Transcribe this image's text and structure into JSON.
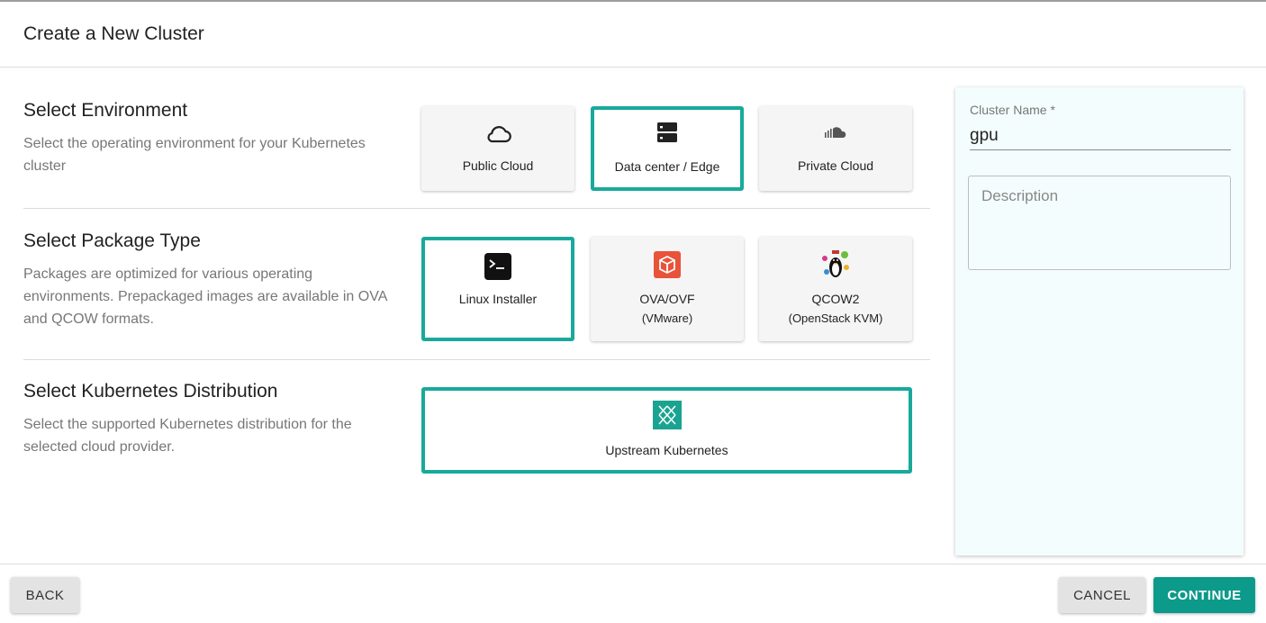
{
  "dialog": {
    "title": "Create a New Cluster"
  },
  "environment": {
    "title": "Select Environment",
    "description": "Select the operating environment for your Kubernetes cluster",
    "options": [
      {
        "label": "Public Cloud",
        "icon": "cloud-outline-icon",
        "selected": false
      },
      {
        "label": "Data center / Edge",
        "icon": "server-icon",
        "selected": true
      },
      {
        "label": "Private Cloud",
        "icon": "soundcloud-icon",
        "selected": false
      }
    ]
  },
  "package": {
    "title": "Select Package Type",
    "description": "Packages are optimized for various operating environments. Prepackaged images are available in OVA and QCOW formats.",
    "options": [
      {
        "label": "Linux Installer",
        "sub": "",
        "icon": "terminal-icon",
        "selected": true
      },
      {
        "label": "OVA/OVF",
        "sub": "(VMware)",
        "icon": "vmware-box-icon",
        "selected": false
      },
      {
        "label": "QCOW2",
        "sub": "(OpenStack KVM)",
        "icon": "kvm-penguin-icon",
        "selected": false
      }
    ]
  },
  "distribution": {
    "title": "Select Kubernetes Distribution",
    "description": "Select the supported Kubernetes distribution for the selected cloud provider.",
    "options": [
      {
        "label": "Upstream Kubernetes",
        "icon": "kubernetes-icon",
        "selected": true
      }
    ]
  },
  "form": {
    "cluster_name_label": "Cluster Name *",
    "cluster_name_value": "gpu",
    "description_placeholder": "Description"
  },
  "footer": {
    "back_label": "BACK",
    "cancel_label": "CANCEL",
    "continue_label": "CONTINUE"
  },
  "colors": {
    "accent": "#19a99c",
    "primary_button": "#0c9a8a",
    "side_panel": "#f4fdfd"
  }
}
